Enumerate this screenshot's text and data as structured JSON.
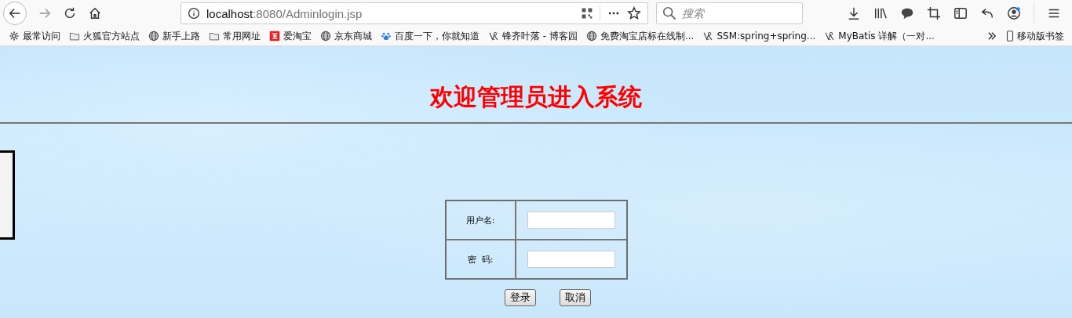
{
  "toolbar": {
    "url": {
      "host": "localhost",
      "path": ":8080/Adminlogin.jsp"
    },
    "search": {
      "placeholder": "搜索"
    }
  },
  "bookmarks": [
    {
      "kind": "gear",
      "label": "最常访问"
    },
    {
      "kind": "folder",
      "label": "火狐官方站点"
    },
    {
      "kind": "globe",
      "label": "新手上路"
    },
    {
      "kind": "folder",
      "label": "常用网址"
    },
    {
      "kind": "taobao",
      "label": "爱淘宝"
    },
    {
      "kind": "globe",
      "label": "京东商城"
    },
    {
      "kind": "paw",
      "label": "百度一下，你就知道"
    },
    {
      "kind": "bird",
      "label": "锋齐叶落 - 博客园"
    },
    {
      "kind": "globe",
      "label": "免费淘宝店标在线制..."
    },
    {
      "kind": "bird",
      "label": "SSM:spring+spring..."
    },
    {
      "kind": "bird",
      "label": "MyBatis 详解（一对..."
    }
  ],
  "mobile_bookmarks": {
    "label": "移动版书签"
  },
  "page": {
    "heading": "欢迎管理员进入系统",
    "form": {
      "rows": [
        {
          "label": "用户名:"
        },
        {
          "label": "密  码:"
        }
      ],
      "buttons": [
        "登录",
        "取消"
      ]
    }
  }
}
